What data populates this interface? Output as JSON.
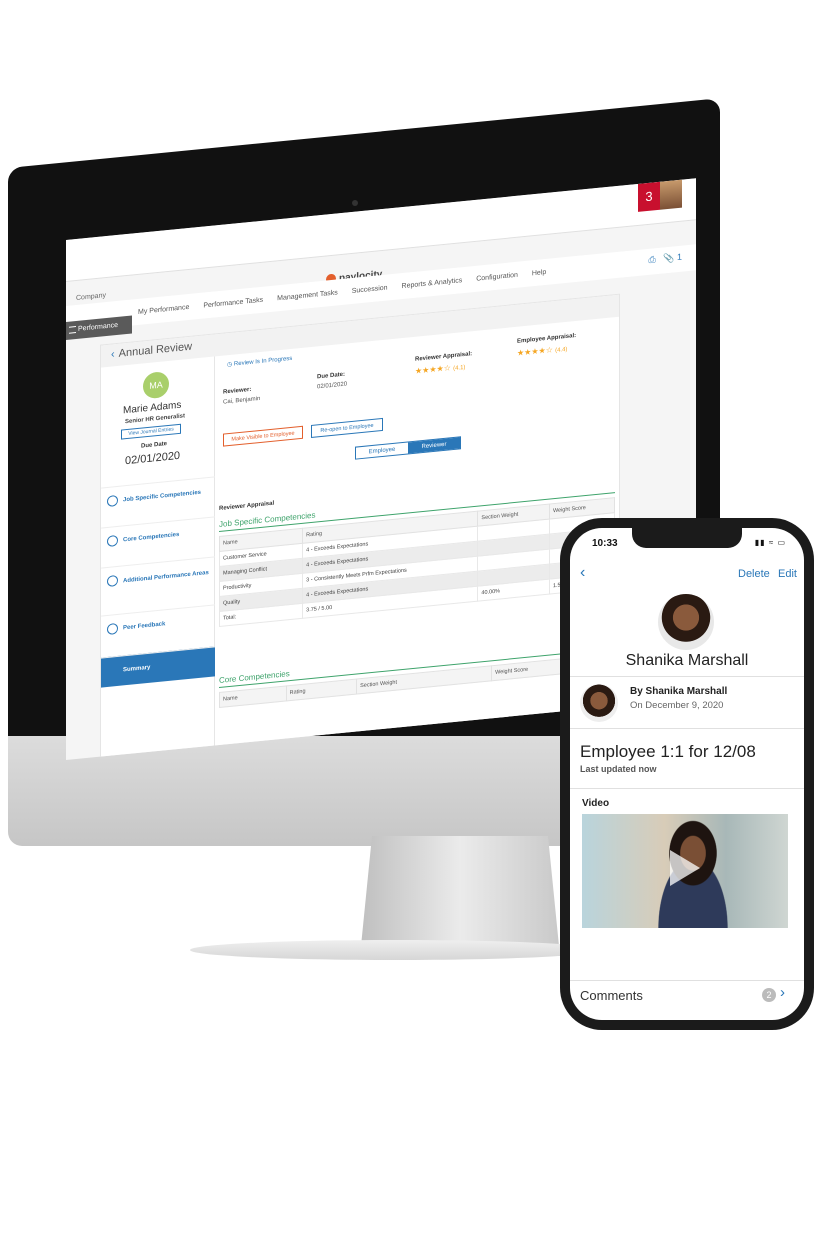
{
  "desktop": {
    "notification_count": "3",
    "logo_text": "paylocity",
    "company_label": "Company",
    "performance_tab": "Performance",
    "nav_items": [
      "My Performance",
      "Performance Tasks",
      "Management Tasks",
      "Succession",
      "Reports & Analytics",
      "Configuration",
      "Help"
    ],
    "attachment_count": "1",
    "page_title": "Annual Review",
    "employee": {
      "initials": "MA",
      "name": "Marie Adams",
      "title": "Senior HR Generalist",
      "journal_button": "View Journal Entries",
      "due_label": "Due Date",
      "due_date": "02/01/2020"
    },
    "sidebar": [
      {
        "label": "Job Specific Competencies"
      },
      {
        "label": "Core Competencies"
      },
      {
        "label": "Additional Performance Areas"
      },
      {
        "label": "Peer Feedback"
      },
      {
        "label": "Summary"
      }
    ],
    "review": {
      "status": "Review Is In Progress",
      "reviewer_label": "Reviewer:",
      "reviewer_name": "Cai, Benjamin",
      "due_label": "Due Date:",
      "due_value": "02/01/2020",
      "reviewer_appraisal_label": "Reviewer Appraisal:",
      "reviewer_appraisal_value": "(4.1)",
      "reviewer_rating": 4.1,
      "employee_appraisal_label": "Employee Appraisal:",
      "employee_appraisal_value": "(4.4)",
      "employee_rating": 4.4,
      "make_visible_button": "Make Visible to Employee",
      "reopen_button": "Re-open to Employee",
      "toggle": [
        "Employee",
        "Reviewer"
      ],
      "toggle_selected": "Reviewer",
      "section_label": "Reviewer Appraisal"
    },
    "job_competencies": {
      "title": "Job Specific Competencies",
      "columns": [
        "Name",
        "Rating",
        "Section Weight",
        "Weight Score"
      ],
      "rows": [
        [
          "Customer Service",
          "4 - Exceeds Expectations",
          "",
          ""
        ],
        [
          "Managing Conflict",
          "4 - Exceeds Expectations",
          "",
          ""
        ],
        [
          "Productivity",
          "3 - Consistently Meets Prfm Expectations",
          "",
          ""
        ],
        [
          "Quality",
          "4 - Exceeds Expectations",
          "",
          ""
        ],
        [
          "Total:",
          "3.75 / 5.00",
          "40.00%",
          "1.50"
        ]
      ]
    },
    "core_competencies": {
      "title": "Core Competencies",
      "columns": [
        "Name",
        "Rating",
        "Section Weight",
        "Weight Score"
      ]
    }
  },
  "phone": {
    "time": "10:33",
    "delete_label": "Delete",
    "edit_label": "Edit",
    "profile_name": "Shanika Marshall",
    "author": "By Shanika Marshall",
    "date": "On December 9, 2020",
    "heading": "Employee 1:1 for 12/08",
    "updated": "Last updated now",
    "video_label": "Video",
    "comments_label": "Comments",
    "comments_count": "2"
  },
  "colors": {
    "accent_blue": "#2a77b8",
    "accent_green": "#3ea36b",
    "accent_orange": "#e35f2c",
    "notification_red": "#c8102e",
    "star_gold": "#f5a623"
  }
}
